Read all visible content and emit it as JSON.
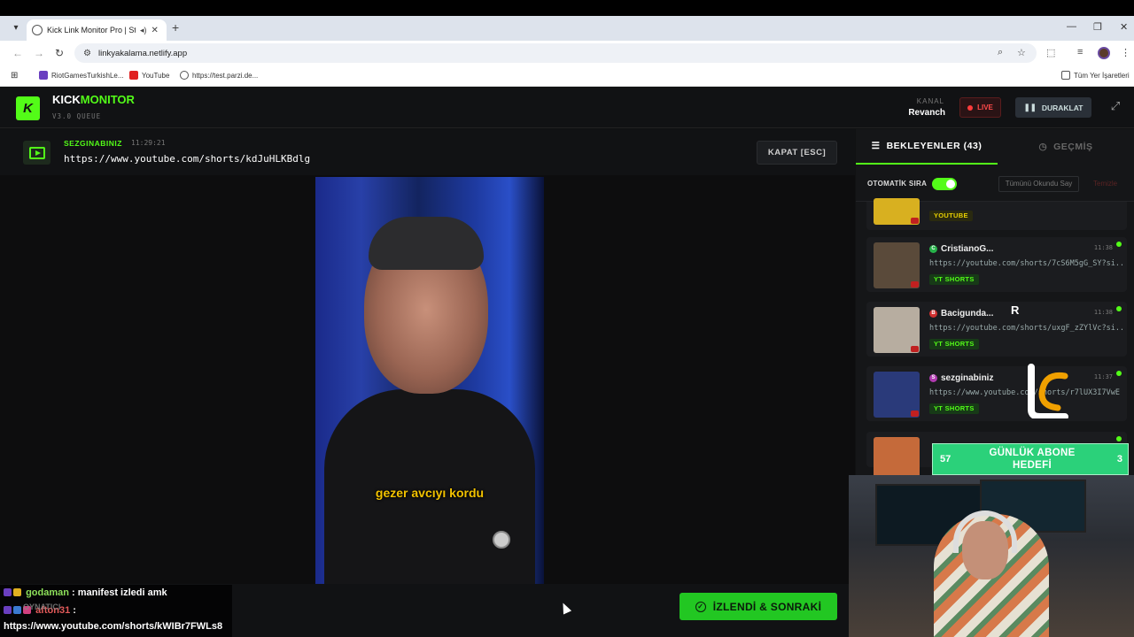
{
  "browser": {
    "tab_title": "Kick Link Monitor Pro | Stre",
    "url": "linkyakalama.netlify.app",
    "bookmarks": [
      {
        "label": "RiotGamesTurkishLe...",
        "color": "#6a3fc0"
      },
      {
        "label": "YouTube",
        "color": "#e02020"
      },
      {
        "label": "https://test.parzi.de...",
        "color": "#555555"
      }
    ],
    "all_bookmarks": "Tüm Yer İşaretleri"
  },
  "app": {
    "logo_letter": "K",
    "brand_kick": "KICK",
    "brand_monitor": "MONITOR",
    "version": "V3.0 QUEUE",
    "kanal_label": "KANAL",
    "kanal_value": "Revanch",
    "live_label": "LIVE",
    "pause_label": "DURAKLAT",
    "accent": "#53fc18"
  },
  "now_playing": {
    "user": "SEZGINABINIZ",
    "time": "11:29:21",
    "url": "https://www.youtube.com/shorts/kdJuHLKBdlg",
    "close_label": "KAPAT [ESC]",
    "caption": "gezer avcıyı kordu",
    "done_label": "İZLENDİ & SONRAKİ"
  },
  "sidebar": {
    "tab_waiting": "BEKLEYENLER (43)",
    "tab_history": "GEÇMİŞ",
    "auto_label": "OTOMATİK SIRA",
    "auto_on": true,
    "mark_read": "Tümünü Okundu Say",
    "clear": "Temizle",
    "queue": [
      {
        "name": "",
        "time": "",
        "url": "",
        "tag": "YOUTUBE",
        "av_color": "#888888",
        "thumb": "#d8b020"
      },
      {
        "name": "CristianoG...",
        "time": "11:38",
        "url": "https://youtube.com/shorts/7cS6M5gG_SY?si...",
        "tag": "YT SHORTS",
        "av_color": "#27b24a",
        "thumb": "#5a4a3a"
      },
      {
        "name": "Bacigunda...",
        "time": "11:38",
        "url": "https://youtube.com/shorts/uxgF_zZYlVc?si...",
        "tag": "YT SHORTS",
        "av_color": "#d03030",
        "thumb": "#b7ada0"
      },
      {
        "name": "sezginabiniz",
        "time": "11:37",
        "url": "https://www.youtube.com/shorts/r7lUX3I7VwE",
        "tag": "YT SHORTS",
        "av_color": "#b03ab0",
        "thumb": "#2a3a7a"
      }
    ]
  },
  "overlay": {
    "goal_left": "57",
    "goal_title": "GÜNLÜK ABONE HEDEFİ",
    "goal_right": "3",
    "chat": [
      {
        "user": "godaman",
        "text": ": manifest izledi amk"
      },
      {
        "user": "afton31",
        "text": ":",
        "ghost": "OYNATICI"
      },
      {
        "user": "",
        "text": "https://www.youtube.com/shorts/kWIBr7FWLs8"
      }
    ]
  }
}
